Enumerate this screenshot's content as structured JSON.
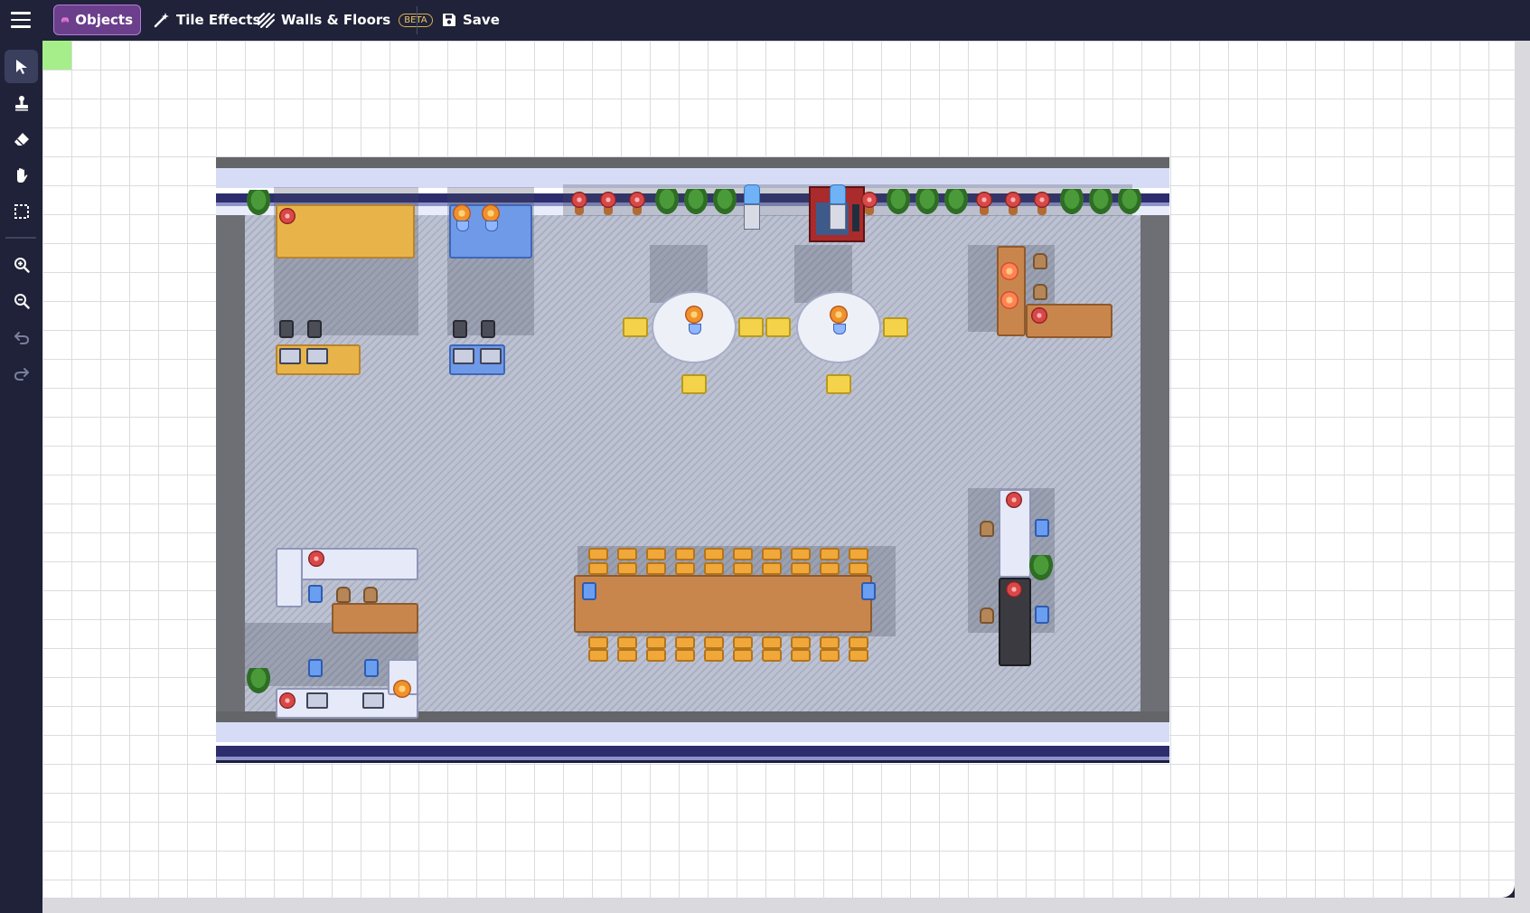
{
  "toolbar": {
    "menu_icon": "hamburger-menu-icon",
    "tabs": [
      {
        "label": "Objects",
        "icon": "sofa-icon",
        "active": true
      },
      {
        "label": "Tile Effects",
        "icon": "magic-wand-icon",
        "active": false
      },
      {
        "label": "Walls & Floors",
        "icon": "hatch-pattern-icon",
        "badge": "BETA",
        "active": false
      }
    ],
    "save_label": "Save",
    "save_icon": "floppy-disk-icon"
  },
  "side_tools": [
    {
      "name": "select",
      "icon": "cursor-arrow-icon",
      "active": true
    },
    {
      "name": "stamp",
      "icon": "stamp-icon",
      "active": false
    },
    {
      "name": "eraser",
      "icon": "eraser-icon",
      "active": false
    },
    {
      "name": "pan",
      "icon": "hand-icon",
      "active": false
    },
    {
      "name": "region-select",
      "icon": "dashed-square-icon",
      "active": false
    },
    {
      "name": "zoom-in",
      "icon": "zoom-in-icon",
      "active": false
    },
    {
      "name": "zoom-out",
      "icon": "zoom-out-icon",
      "active": false
    },
    {
      "name": "undo",
      "icon": "undo-icon",
      "active": false
    },
    {
      "name": "redo",
      "icon": "redo-icon",
      "active": false
    }
  ],
  "colors": {
    "chrome_bg": "#1f2238",
    "active_tab_bg": "#6b3f8c",
    "active_tab_border": "#b57ad8",
    "beta_badge": "#f0c86a",
    "spawn_tile": "#a5ee8a",
    "floor": "#b7bccd",
    "wall": "#6e6f74"
  }
}
